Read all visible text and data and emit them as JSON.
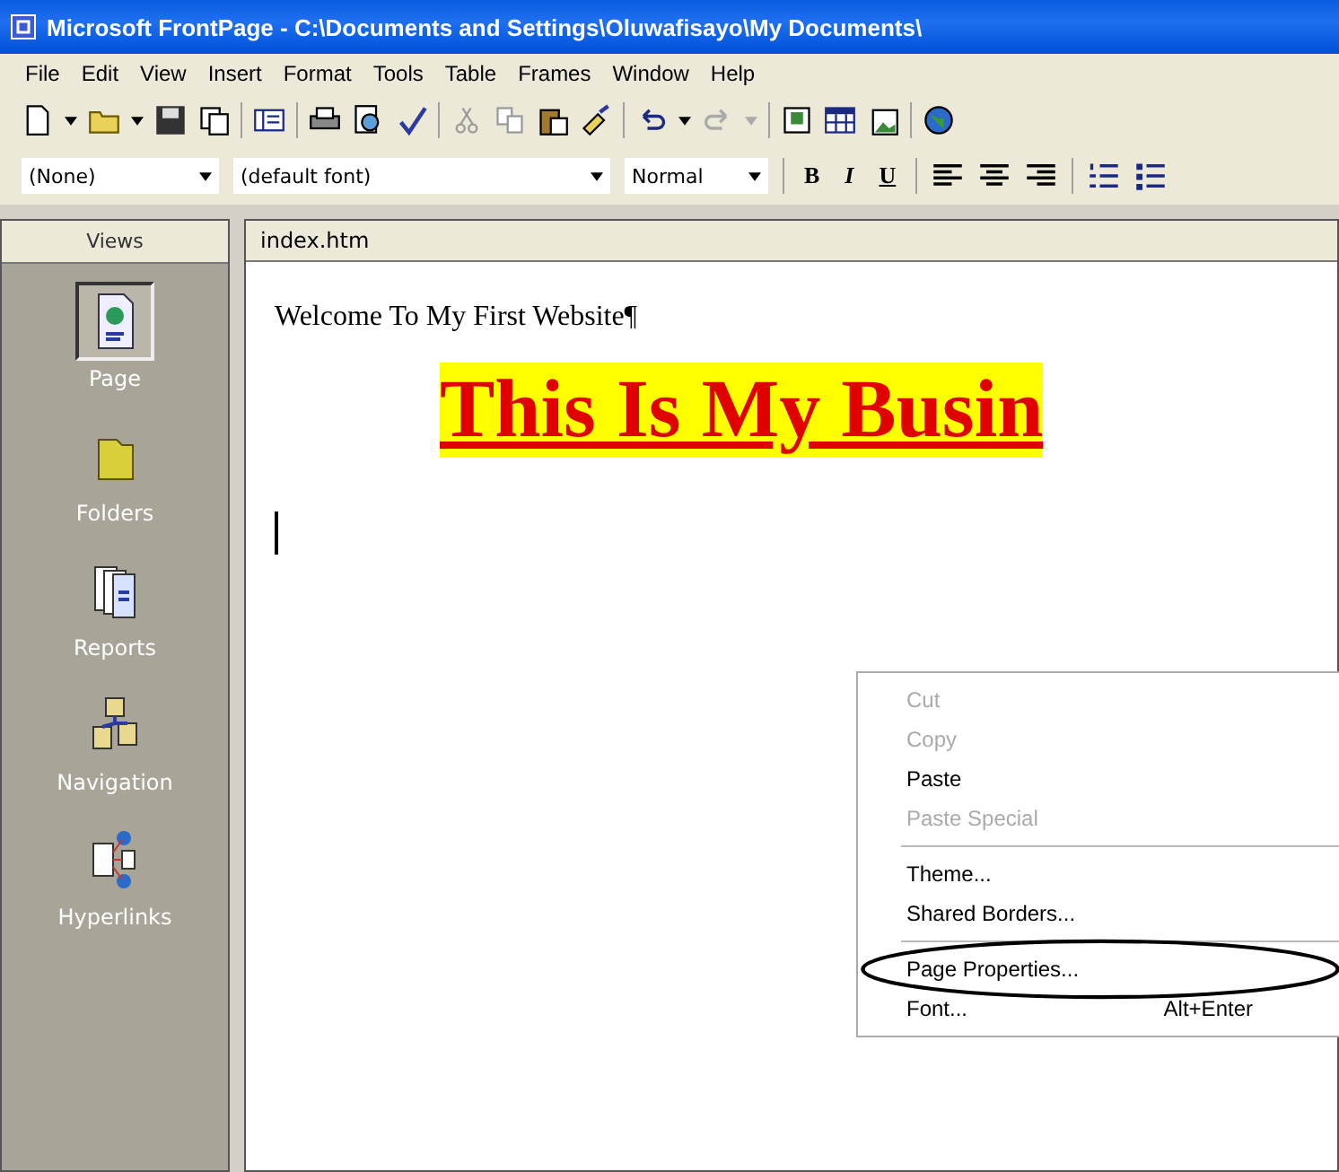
{
  "window": {
    "title": "Microsoft FrontPage - C:\\Documents and Settings\\Oluwafisayo\\My Documents\\"
  },
  "menu_bar": [
    "File",
    "Edit",
    "View",
    "Insert",
    "Format",
    "Tools",
    "Table",
    "Frames",
    "Window",
    "Help"
  ],
  "formatting_toolbar": {
    "style": "(None)",
    "font": "(default font)",
    "size": "Normal",
    "bold": "B",
    "italic": "I",
    "underline": "U"
  },
  "views_bar": {
    "title": "Views",
    "items": [
      {
        "label": "Page",
        "selected": true
      },
      {
        "label": "Folders",
        "selected": false
      },
      {
        "label": "Reports",
        "selected": false
      },
      {
        "label": "Navigation",
        "selected": false
      },
      {
        "label": "Hyperlinks",
        "selected": false
      }
    ]
  },
  "document": {
    "tab": "index.htm",
    "paragraph": "Welcome To My First Website¶",
    "heading": "This Is My Busin"
  },
  "context_menu": [
    {
      "kind": "item",
      "label": "Cut",
      "disabled": true
    },
    {
      "kind": "item",
      "label": "Copy",
      "disabled": true
    },
    {
      "kind": "item",
      "label": "Paste",
      "disabled": false
    },
    {
      "kind": "item",
      "label": "Paste Special",
      "disabled": true
    },
    {
      "kind": "separator"
    },
    {
      "kind": "item",
      "label": "Theme...",
      "disabled": false
    },
    {
      "kind": "item",
      "label": "Shared Borders...",
      "disabled": false
    },
    {
      "kind": "separator"
    },
    {
      "kind": "item",
      "label": "Page Properties...",
      "disabled": false,
      "circled": true
    },
    {
      "kind": "item",
      "label": "Font...",
      "disabled": false,
      "shortcut": "Alt+Enter"
    }
  ]
}
